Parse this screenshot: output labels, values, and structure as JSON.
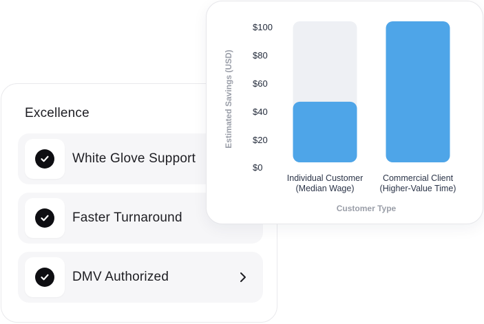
{
  "excellence": {
    "title": "Excellence",
    "items": [
      {
        "label": "White Glove Support",
        "icon": "check-circle-icon"
      },
      {
        "label": "Faster Turnaround",
        "icon": "check-circle-icon"
      },
      {
        "label": "DMV Authorized",
        "icon": "check-circle-icon",
        "trailing_icon": "chevron-right-icon"
      }
    ]
  },
  "colors": {
    "bar": "#4ea5e8",
    "bar_track": "#eef0f4",
    "check_bg": "#0e0e12"
  },
  "chart_data": {
    "type": "bar",
    "categories": [
      "Individual Customer\n(Median Wage)",
      "Commercial Client\n(Higher-Value Time)"
    ],
    "values": [
      43,
      100
    ],
    "ylabel": "Estimated Savings (USD)",
    "xlabel": "Customer Type",
    "ylim": [
      0,
      100
    ],
    "yticks": [
      "$0",
      "$20",
      "$40",
      "$60",
      "$80",
      "$100"
    ],
    "track_max": 100,
    "grid": false,
    "legend": "none"
  }
}
